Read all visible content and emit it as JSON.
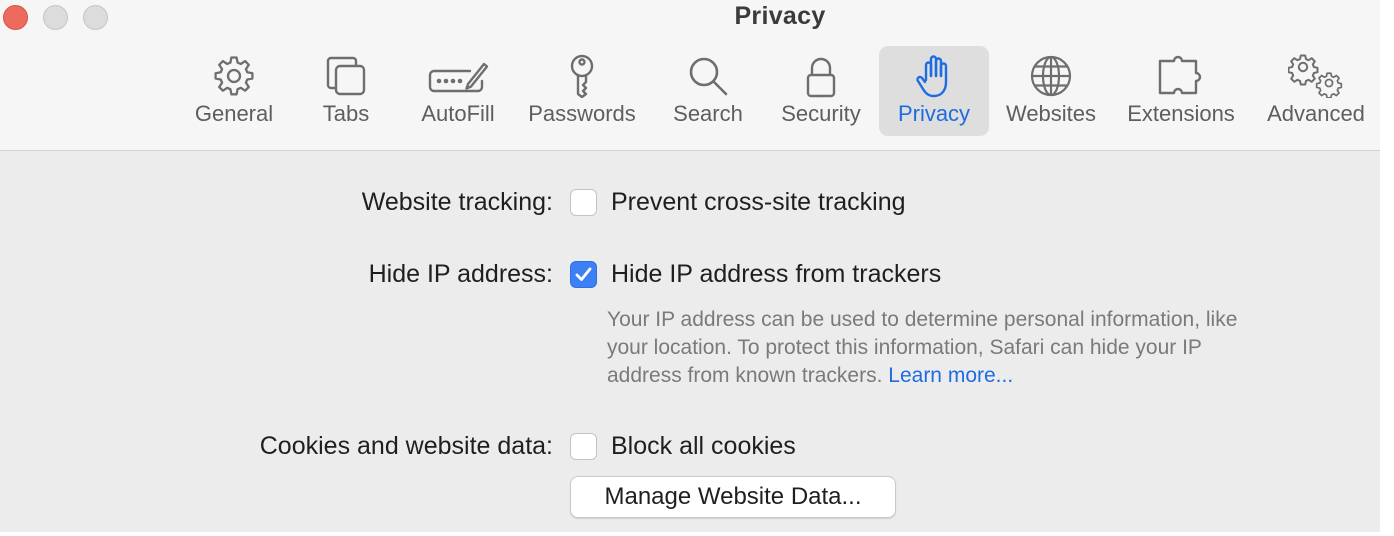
{
  "window": {
    "title": "Privacy"
  },
  "toolbar": {
    "tabs": [
      {
        "label": "General",
        "icon": "gear-icon"
      },
      {
        "label": "Tabs",
        "icon": "tabs-icon"
      },
      {
        "label": "AutoFill",
        "icon": "autofill-icon"
      },
      {
        "label": "Passwords",
        "icon": "key-icon"
      },
      {
        "label": "Search",
        "icon": "search-icon"
      },
      {
        "label": "Security",
        "icon": "lock-icon"
      },
      {
        "label": "Privacy",
        "icon": "hand-icon",
        "selected": true
      },
      {
        "label": "Websites",
        "icon": "globe-icon"
      },
      {
        "label": "Extensions",
        "icon": "puzzle-icon"
      },
      {
        "label": "Advanced",
        "icon": "gears-icon"
      }
    ]
  },
  "privacy": {
    "website_tracking": {
      "label": "Website tracking:",
      "option": "Prevent cross-site tracking",
      "checked": false
    },
    "hide_ip": {
      "label": "Hide IP address:",
      "option": "Hide IP address from trackers",
      "checked": true,
      "description_lines": [
        "Your IP address can be used to determine personal information, like",
        "your location. To protect this information, Safari can hide your IP",
        "address from known trackers."
      ],
      "learn_more": "Learn more..."
    },
    "cookies": {
      "label": "Cookies and website data:",
      "option": "Block all cookies",
      "checked": false,
      "manage_button": "Manage Website Data..."
    }
  },
  "colors": {
    "accent": "#1f6ce0",
    "checkbox_checked": "#3d80f5",
    "close_button": "#ed6a5e",
    "window_background": "#ececec"
  }
}
